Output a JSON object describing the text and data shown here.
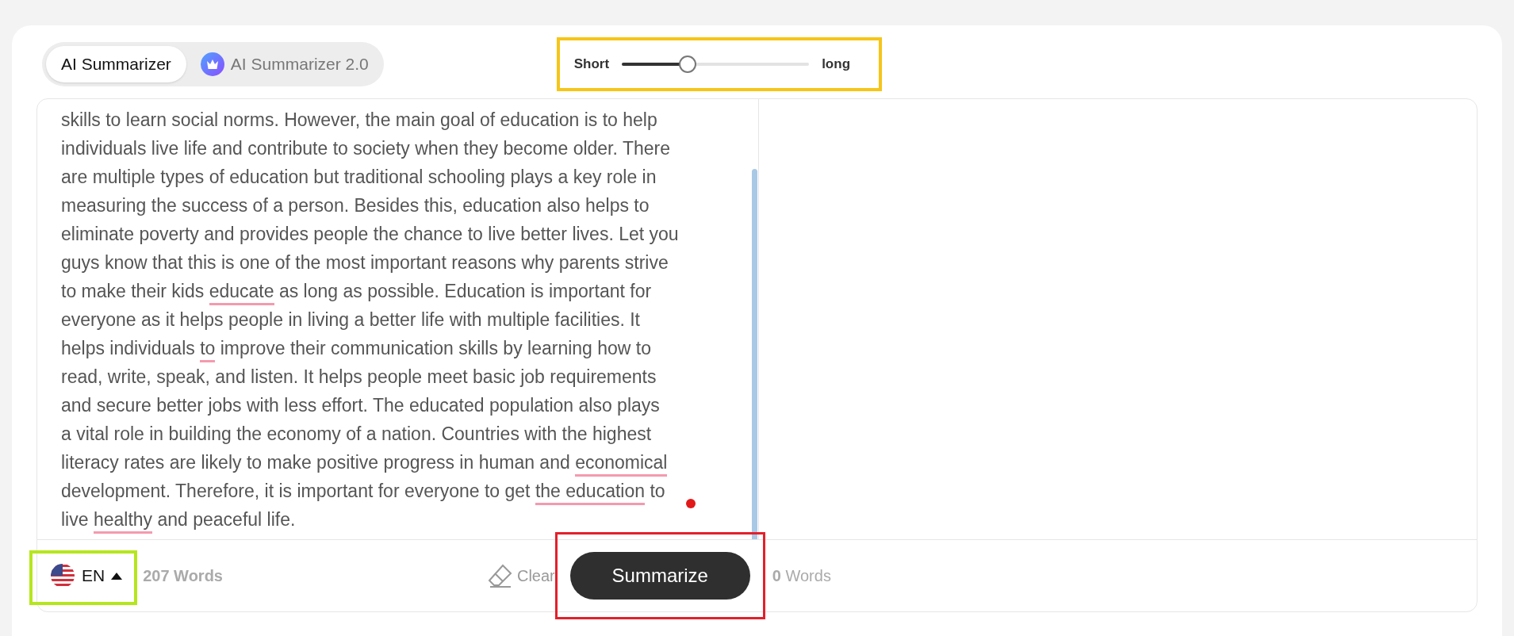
{
  "tabs": [
    {
      "label": "AI Summarizer",
      "selected": true,
      "kind": "plain"
    },
    {
      "label": "AI Summarizer 2.0",
      "selected": false,
      "kind": "crown"
    }
  ],
  "length_slider": {
    "min_label": "Short",
    "max_label": "long",
    "level": 0.35
  },
  "input_text": [
    {
      "text": "skills to learn social norms. However, the main goal of education is to help\nindividuals live life and contribute to society when they become older. There\nare multiple types of education but traditional schooling plays a key role in\nmeasuring the success of a person. Besides this, education also helps to\neliminate poverty and provides people the chance to live better lives. Let you\nguys know that this is one of the most important reasons why parents strive\nto make their kids ",
      "flagged": false
    },
    {
      "text": "educate",
      "flagged": true
    },
    {
      "text": " as long as possible. Education is important for\neveryone as it helps people in living a better life with multiple facilities. It\nhelps individuals ",
      "flagged": false
    },
    {
      "text": "to",
      "flagged": true
    },
    {
      "text": " improve their communication skills by learning how to\nread, write, speak, and listen. It helps people meet basic job requirements\nand secure better jobs with less effort. The educated population also plays\na vital role in building the economy of a nation. Countries with the highest\nliteracy rates are likely to make positive progress in human and ",
      "flagged": false
    },
    {
      "text": "economical",
      "flagged": true
    },
    {
      "text": "\ndevelopment. Therefore, it is important for everyone to get ",
      "flagged": false
    },
    {
      "text": "the education",
      "flagged": true
    },
    {
      "text": " to\nlive ",
      "flagged": false
    },
    {
      "text": "healthy",
      "flagged": true
    },
    {
      "text": " and peaceful life.",
      "flagged": false
    }
  ],
  "language": {
    "code": "EN"
  },
  "input_word_count": "207 Words",
  "clear_button": "Clear",
  "summarize_button": {
    "label": "Summarize"
  },
  "output_word_count": {
    "number": "0",
    "label": "Words"
  }
}
